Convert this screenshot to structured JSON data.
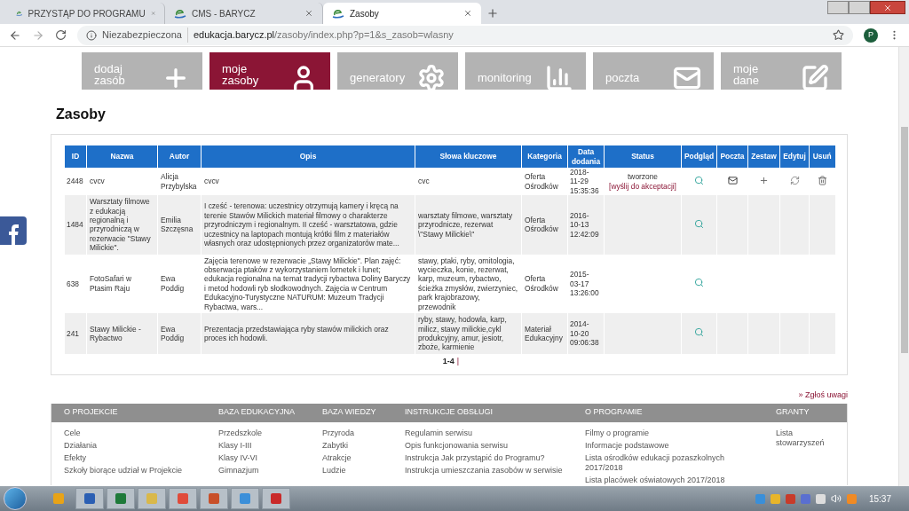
{
  "browser": {
    "tabs": [
      {
        "title": "PRZYSTĄP DO PROGRAMU",
        "selected": false
      },
      {
        "title": "CMS - BARYCZ",
        "selected": false
      },
      {
        "title": "Zasoby",
        "selected": true
      }
    ],
    "security": "Niezabezpieczona",
    "url_domain": "edukacja.barycz.pl",
    "url_path": "/zasoby/index.php?p=1&s_zasob=wlasny",
    "profile": "P"
  },
  "nav": [
    {
      "lines": [
        "dodaj",
        "zasób"
      ],
      "selected": false
    },
    {
      "lines": [
        "moje",
        "zasoby"
      ],
      "selected": true
    },
    {
      "lines": [
        "generatory"
      ],
      "selected": false
    },
    {
      "lines": [
        "monitoring"
      ],
      "selected": false
    },
    {
      "lines": [
        "poczta"
      ],
      "selected": false
    },
    {
      "lines": [
        "moje",
        "dane"
      ],
      "selected": false
    }
  ],
  "title": "Zasoby",
  "table": {
    "columns": [
      "ID",
      "Nazwa",
      "Autor",
      "Opis",
      "Słowa kluczowe",
      "Kategoria",
      "Data dodania",
      "Status",
      "Podgląd",
      "Poczta",
      "Zestaw",
      "Edytuj",
      "Usuń"
    ],
    "rows": [
      {
        "id": "2448",
        "name": "cvcv",
        "author": "Alicja Przybylska",
        "description": "cvcv",
        "keywords": "cvc",
        "category": "Oferta Ośrodków",
        "date": "2018-\n11-29\n15:35:36",
        "status": "tworzone",
        "status_link": "[wyślij do akceptacji]",
        "preview": true,
        "mail": true,
        "set": true,
        "edit": true,
        "delete": true
      },
      {
        "id": "1484",
        "name": "Warsztaty filmowe z edukacją regionalną i przyrodniczą w rezerwacie \"Stawy Milickie\".",
        "author": "Emilia Szczęsna",
        "description": "I cześć - terenowa: uczestnicy otrzymują kamery i kręcą na terenie Stawów Milickich materiał filmowy o charakterze przyrodniczym i regionalnym. II cześć - warsztatowa, gdzie uczestnicy na laptopach montują krótki film z materiałów własnych oraz udostępnionych przez organizatorów mate...",
        "keywords": "warsztaty filmowe, warsztaty przyrodnicze, rezerwat \\\"Stawy Milickie\\\"",
        "category": "Oferta Ośrodków",
        "date": "2016-\n10-13\n12:42:09",
        "preview": true,
        "mail": false,
        "set": false,
        "edit": false,
        "delete": false
      },
      {
        "id": "638",
        "name": "FotoSafari w Ptasim Raju",
        "author": "Ewa Poddig",
        "description": "Zajęcia terenowe w rezerwacie „Stawy Milickie\". Plan zajęć: obserwacja ptaków z wykorzystaniem lornetek i lunet; edukacja regionalna na temat tradycji rybactwa Doliny Baryczy i metod hodowli ryb słodkowodnych. Zajęcia w Centrum Edukacyjno-Turystyczne NATURUM: Muzeum Tradycji Rybactwa, wars...",
        "keywords": "stawy, ptaki, ryby, ornitologia, wycieczka, konie, rezerwat, karp, muzeum, rybactwo, ścieżka zmysłów, zwierzyniec, park krajobrazowy, przewodnik",
        "category": "Oferta Ośrodków",
        "date": "2015-\n03-17\n13:26:00",
        "preview": true,
        "mail": false,
        "set": false,
        "edit": false,
        "delete": false
      },
      {
        "id": "241",
        "name": "Stawy Milickie - Rybactwo",
        "author": "Ewa Poddig",
        "description": "Prezentacja przedstawiająca ryby stawów milickich oraz proces ich hodowli.",
        "keywords": "ryby, stawy, hodowla, karp, milicz, stawy milickie,cykl produkcyjny, amur, jesiotr, zboże, karmienie",
        "category": "Materiał Edukacyjny",
        "date": "2014-\n10-20\n09:06:38",
        "preview": true,
        "mail": false,
        "set": false,
        "edit": false,
        "delete": false
      }
    ],
    "pagination": "1-4",
    "pagination_sep": "|"
  },
  "report_link": "» Zgłoś uwagi",
  "footer": [
    {
      "heading": "O PROJEKCIE",
      "links": [
        "Cele",
        "Działania",
        "Efekty",
        "Szkoły biorące udział w Projekcie"
      ]
    },
    {
      "heading": "BAZA EDUKACYJNA",
      "links": [
        "Przedszkole",
        "Klasy I-III",
        "Klasy IV-VI",
        "Gimnazjum"
      ]
    },
    {
      "heading": "BAZA WIEDZY",
      "links": [
        "Przyroda",
        "Zabytki",
        "Atrakcje",
        "Ludzie"
      ]
    },
    {
      "heading": "INSTRUKCJE OBSŁUGI",
      "links": [
        "Regulamin serwisu",
        "Opis funkcjonowania serwisu",
        "Instrukcja Jak przystąpić do Programu?",
        "Instrukcja umieszczania zasobów w serwisie"
      ]
    },
    {
      "heading": "O PROGRAMIE",
      "links": [
        "Filmy o programie",
        "Informacje podstawowe",
        "Lista ośrodków edukacji pozaszkolnych 2017/2018",
        "Lista placówek oświatowych 2017/2018"
      ]
    },
    {
      "heading": "GRANTY",
      "links": [
        "Lista stowarzyszeń"
      ]
    }
  ],
  "taskbar": {
    "time": "15:37"
  }
}
